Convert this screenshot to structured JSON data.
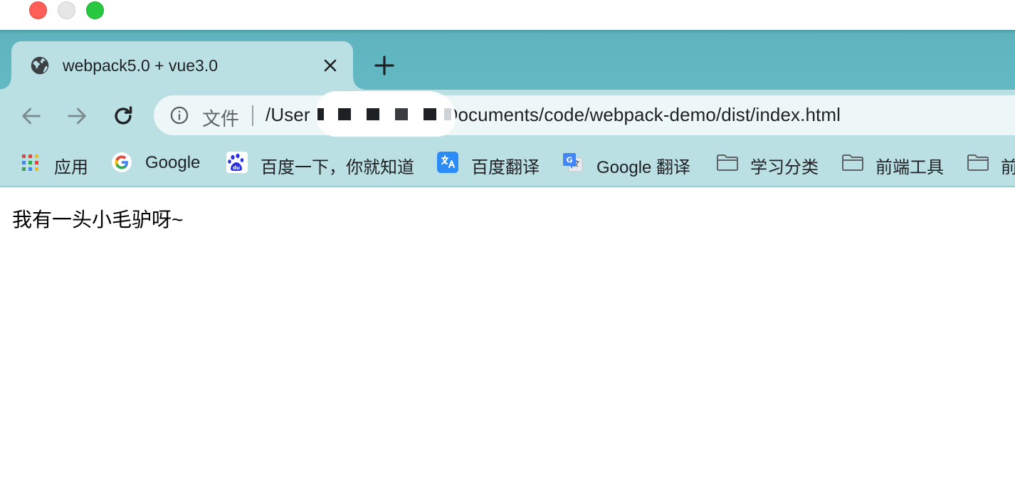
{
  "window": {
    "controls": [
      "close",
      "minimize",
      "zoom"
    ]
  },
  "tab": {
    "title": "webpack5.0 + vue3.0",
    "favicon": "globe-icon"
  },
  "toolbar": {
    "security_label": "文件",
    "url_prefix": "/User",
    "url_suffix": "Documents/code/webpack-demo/dist/index.html"
  },
  "bookmarks": [
    {
      "label": "应用",
      "icon": "apps-grid-icon"
    },
    {
      "label": "Google",
      "icon": "google-icon"
    },
    {
      "label": "百度一下，你就知道",
      "icon": "baidu-icon"
    },
    {
      "label": "百度翻译",
      "icon": "translate-icon"
    },
    {
      "label": "Google 翻译",
      "icon": "google-translate-icon"
    },
    {
      "label": "学习分类",
      "icon": "folder-icon"
    },
    {
      "label": "前端工具",
      "icon": "folder-icon"
    },
    {
      "label": "前",
      "icon": "folder-icon"
    }
  ],
  "page": {
    "text": "我有一头小毛驴呀~"
  },
  "colors": {
    "tab_strip": "#62b9c3",
    "toolbar": "#bbe0e4",
    "omnibox": "#eef7f8"
  }
}
